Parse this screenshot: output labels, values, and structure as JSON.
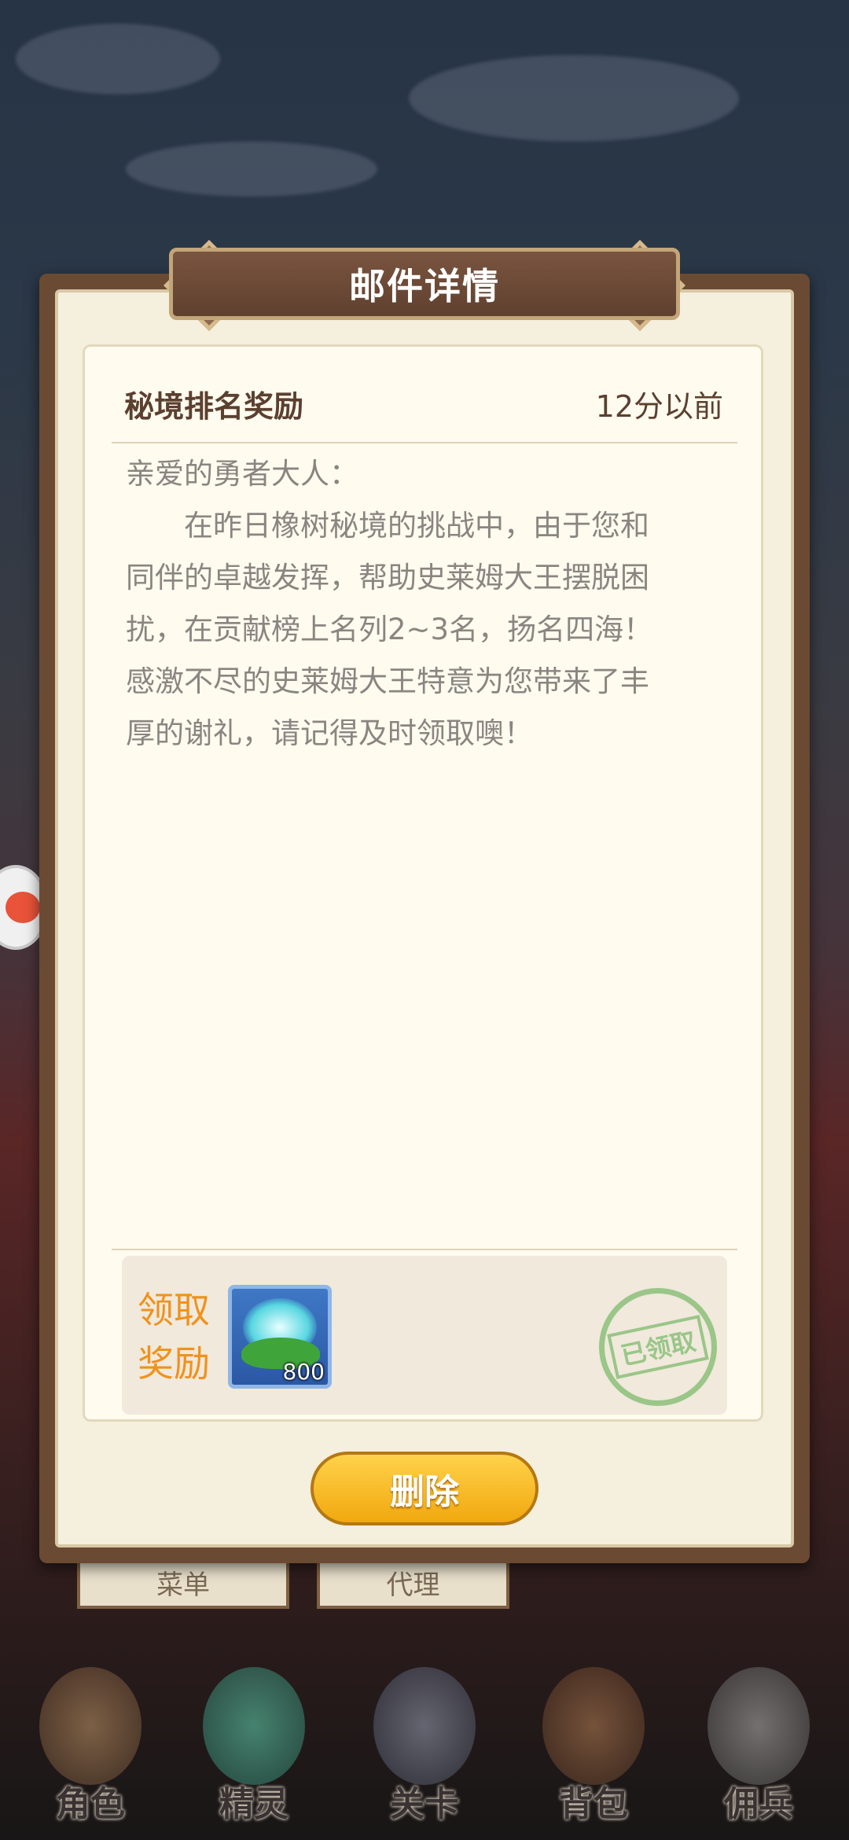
{
  "dialog": {
    "title": "邮件详情"
  },
  "mail": {
    "subject": "秘境排名奖励",
    "time": "12分以前",
    "greeting": "亲爱的勇者大人：",
    "body_lines": [
      "在昨日橡树秘境的挑战中，由于您和",
      "同伴的卓越发挥，帮助史莱姆大王摆脱困",
      "扰，在贡献榜上名列2~3名，扬名四海！",
      "感激不尽的史莱姆大王特意为您带来了丰",
      "厚的谢礼，请记得及时领取噢！"
    ]
  },
  "reward": {
    "label_line1": "领取",
    "label_line2": "奖励",
    "item_icon": "spirit-flower-icon",
    "item_quantity": "800",
    "stamp_text": "已领取"
  },
  "actions": {
    "delete_label": "删除"
  },
  "background_tabs": [
    "菜单",
    "代理"
  ],
  "bottom_nav": [
    {
      "label": "角色",
      "icon": "hero-portrait-icon"
    },
    {
      "label": "精灵",
      "icon": "slime-spirit-icon"
    },
    {
      "label": "关卡",
      "icon": "skull-gate-icon"
    },
    {
      "label": "背包",
      "icon": "backpack-icon"
    },
    {
      "label": "佣兵",
      "icon": "knight-helmet-icon"
    }
  ],
  "colors": {
    "accent_orange": "#f0921c",
    "title_brown": "#6b4a33",
    "button_yellow": "#f1a80f",
    "stamp_green": "#8cc07a"
  }
}
